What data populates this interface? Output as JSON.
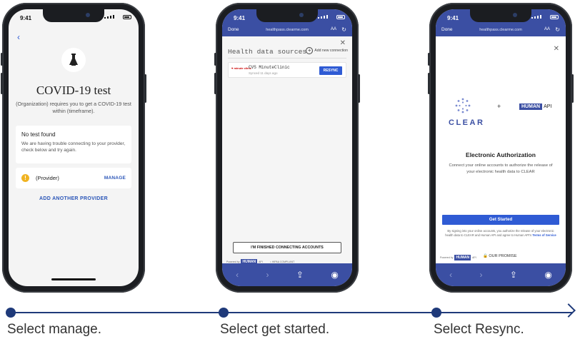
{
  "status": {
    "time": "9:41"
  },
  "screen1": {
    "title": "COVID-19 test",
    "subtitle": "(Organization) requires you to get a COVID-19 test within (timeframe).",
    "no_test_heading": "No test found",
    "no_test_body": "We are having trouble connecting to your provider, check below and try again.",
    "provider_name": "(Provider)",
    "manage_label": "MANAGE",
    "add_provider_label": "ADD ANOTHER PROVIDER"
  },
  "browser": {
    "done_label": "Done",
    "url": "healthpass.clearme.com",
    "text_size_label": "AA"
  },
  "screen2": {
    "heading": "Health data sources",
    "add_connection_label": "Add new connection",
    "source_name": "CVS MinuteClinic",
    "source_logo_text": "minute clinic",
    "synced_text": "Synced 11 days ago",
    "resync_label": "RESYNC",
    "finished_label": "I'M FINISHED CONNECTING ACCOUNTS",
    "powered_by": "Powered by",
    "human_logo": "HUMAN",
    "api_label": "API",
    "hipaa_label": "HIPAA COMPLIANT"
  },
  "screen3": {
    "clear_logo_text": "CLEAR",
    "plus": "+",
    "human_logo": "HUMAN",
    "api_label": "API",
    "heading": "Electronic Authorization",
    "description": "Connect your online accounts to authorize the release of your electronic health data to CLEAR",
    "get_started_label": "Get Started",
    "legal_text": "By signing into your online accounts, you authorize the release of your electronic health data to CLEAR and Human API and agree to Human API's",
    "terms_link": "Terms of Service",
    "powered_by": "Powered by",
    "promise_label": "OUR PROMISE"
  },
  "captions": [
    "Select manage.",
    "Select get started.",
    "Select Resync."
  ],
  "colors": {
    "brand_blue": "#3b4fa3",
    "button_blue": "#2f5bd4",
    "timeline": "#1f3a7a",
    "warning": "#f0b321"
  },
  "icons": [
    "back-chevron-icon",
    "flask-icon",
    "warning-icon",
    "close-icon",
    "plus-circle-icon",
    "reload-icon",
    "share-icon",
    "compass-icon",
    "lock-icon"
  ]
}
